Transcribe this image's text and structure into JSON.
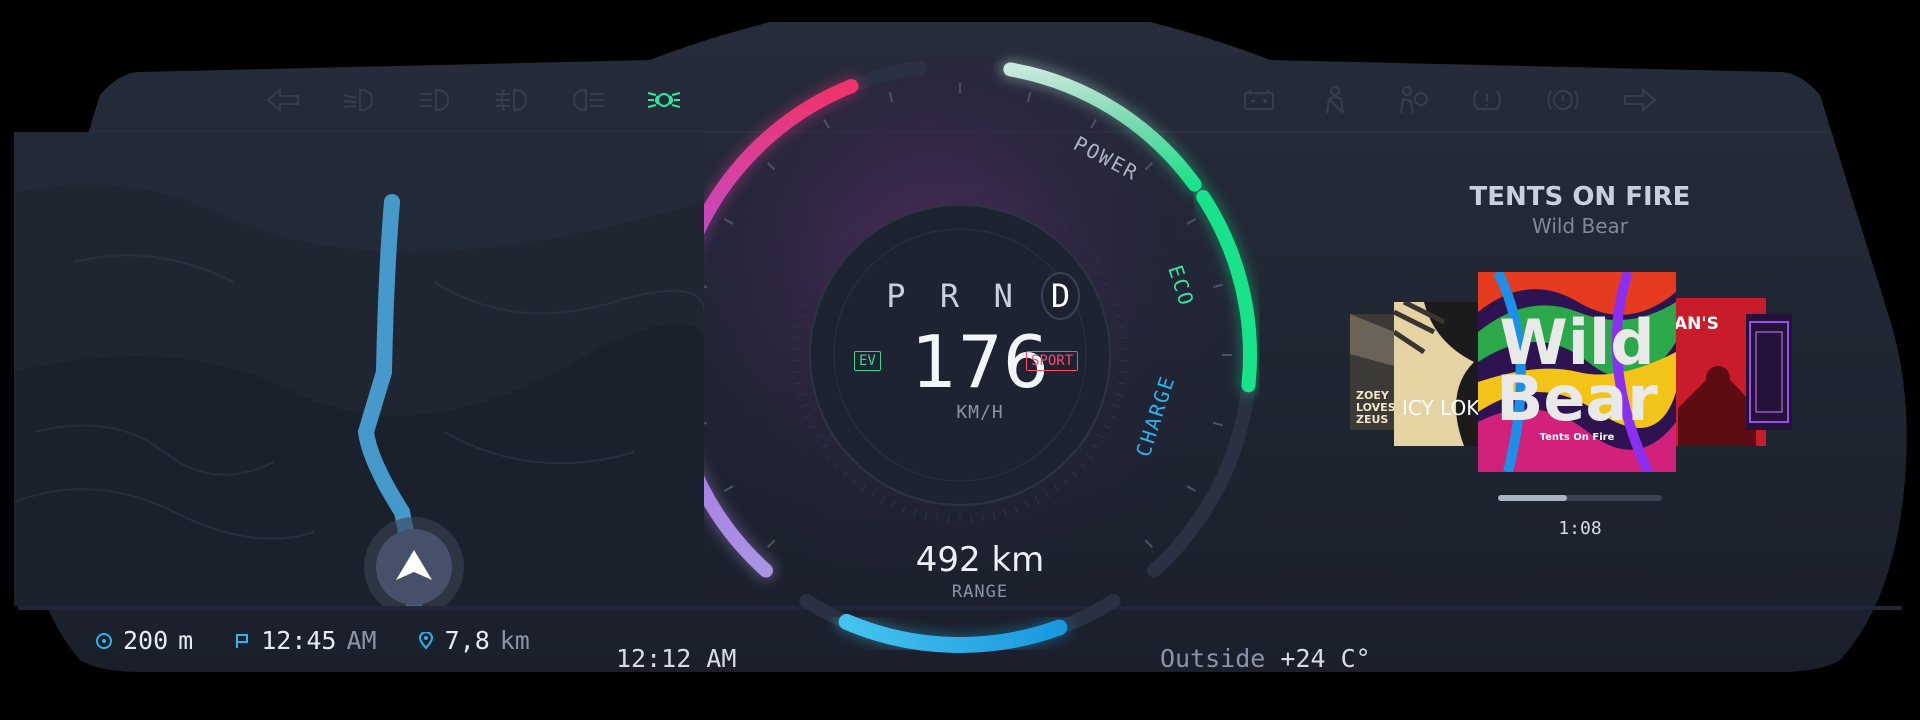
{
  "top_left_icons": [
    {
      "icon": "turn-left-signal-icon",
      "active": false
    },
    {
      "icon": "low-beam-icon",
      "active": false
    },
    {
      "icon": "high-beam-icon",
      "active": false
    },
    {
      "icon": "fog-light-icon",
      "active": false
    },
    {
      "icon": "rear-fog-light-icon",
      "active": false
    },
    {
      "icon": "parking-light-icon",
      "active": true
    }
  ],
  "top_right_icons": [
    {
      "icon": "battery-icon"
    },
    {
      "icon": "seatbelt-icon"
    },
    {
      "icon": "airbag-icon"
    },
    {
      "icon": "tire-pressure-icon"
    },
    {
      "icon": "brake-warning-icon"
    },
    {
      "icon": "turn-right-signal-icon"
    }
  ],
  "navigation": {
    "distance_value": "200",
    "distance_unit": "m",
    "eta_value": "12:45",
    "eta_unit": "AM",
    "remaining_value": "7,8",
    "remaining_unit": "km"
  },
  "clock": "12:12 AM",
  "outside": {
    "label": "Outside",
    "value": "+24 C°"
  },
  "gauge": {
    "gears": [
      "P",
      "R",
      "N",
      "D"
    ],
    "active_gear": "D",
    "speed": "176",
    "speed_unit": "KM/H",
    "ev_label": "EV",
    "mode_label": "SPORT",
    "power_label": "POWER",
    "eco_label": "ECO",
    "charge_label": "CHARGE",
    "range_value": "492 km",
    "range_label": "RANGE"
  },
  "media": {
    "title": "TENTS ON FIRE",
    "artist": "Wild Bear",
    "cover_main_line1": "Wild",
    "cover_main_line2": "Bear",
    "cover_main_sub": "Tents On Fire",
    "cover_left1_text": "ICY LOK",
    "cover_left2_text": "ZOEY LOVES ZEUS",
    "cover_right_text": "AN'S",
    "elapsed": "1:08",
    "progress": 0.42
  },
  "colors": {
    "accent_green": "#2ee6a0",
    "accent_blue": "#2bb4f0",
    "accent_magenta": "#e02f6d",
    "accent_purple": "#a45cf5"
  }
}
